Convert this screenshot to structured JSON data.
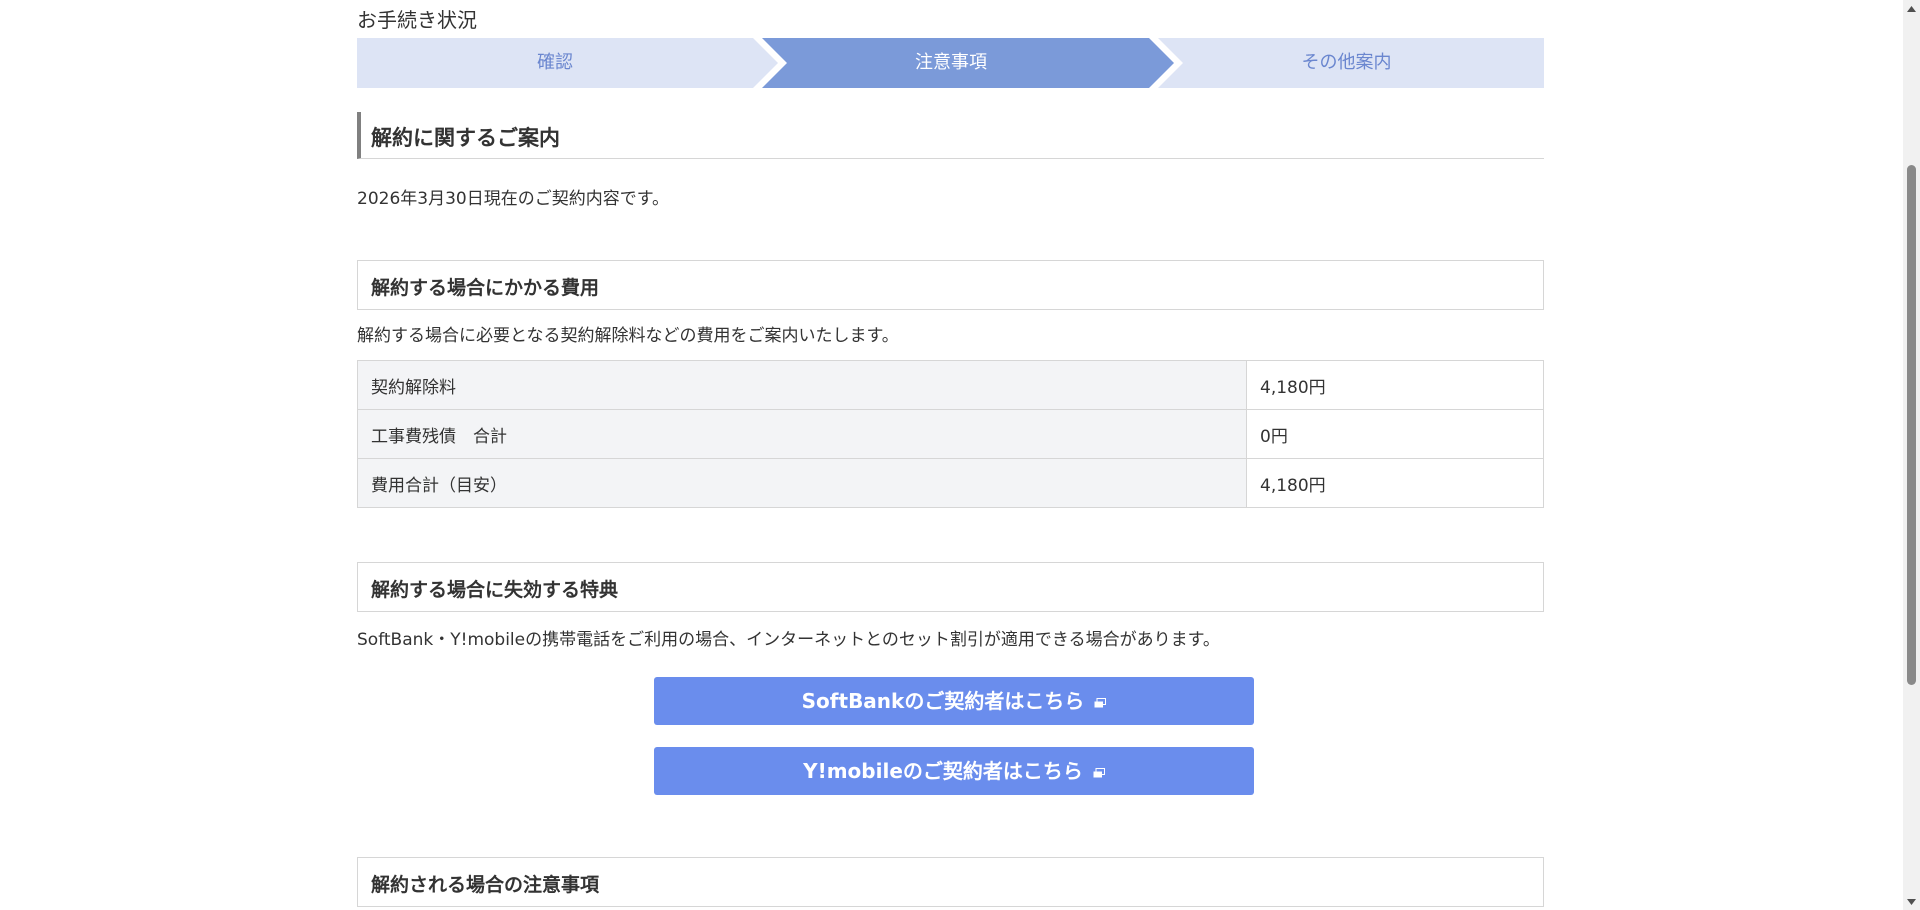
{
  "progress": {
    "title": "お手続き状況",
    "steps": [
      {
        "label": "確認",
        "state": "done"
      },
      {
        "label": "注意事項",
        "state": "current"
      },
      {
        "label": "その他案内",
        "state": "upcoming"
      }
    ]
  },
  "main": {
    "heading": "解約に関するご案内",
    "date_text": "2026年3月30日現在のご契約内容です。"
  },
  "fee_section": {
    "heading": "解約する場合にかかる費用",
    "description": "解約する場合に必要となる契約解除料などの費用をご案内いたします。",
    "rows": [
      {
        "label": "契約解除料",
        "value": "4,180円"
      },
      {
        "label": "工事費残債　合計",
        "value": "0円"
      },
      {
        "label": "費用合計（目安）",
        "value": "4,180円"
      }
    ]
  },
  "benefit_section": {
    "heading": "解約する場合に失効する特典",
    "description": "SoftBank・Y!mobileの携帯電話をご利用の場合、インターネットとのセット割引が適用できる場合があります。",
    "buttons": [
      {
        "label": "SoftBankのご契約者はこちら",
        "icon": "external-link-icon"
      },
      {
        "label": "Y!mobileのご契約者はこちら",
        "icon": "external-link-icon"
      }
    ]
  },
  "notice_section": {
    "heading": "解約される場合の注意事項"
  },
  "colors": {
    "step_done": "#dde4f5",
    "step_current": "#7b9ad9",
    "step_upcoming": "#dde4f5",
    "button": "#6a8ded",
    "table_label_bg": "#f3f4f6",
    "border": "#d6d6d6"
  }
}
